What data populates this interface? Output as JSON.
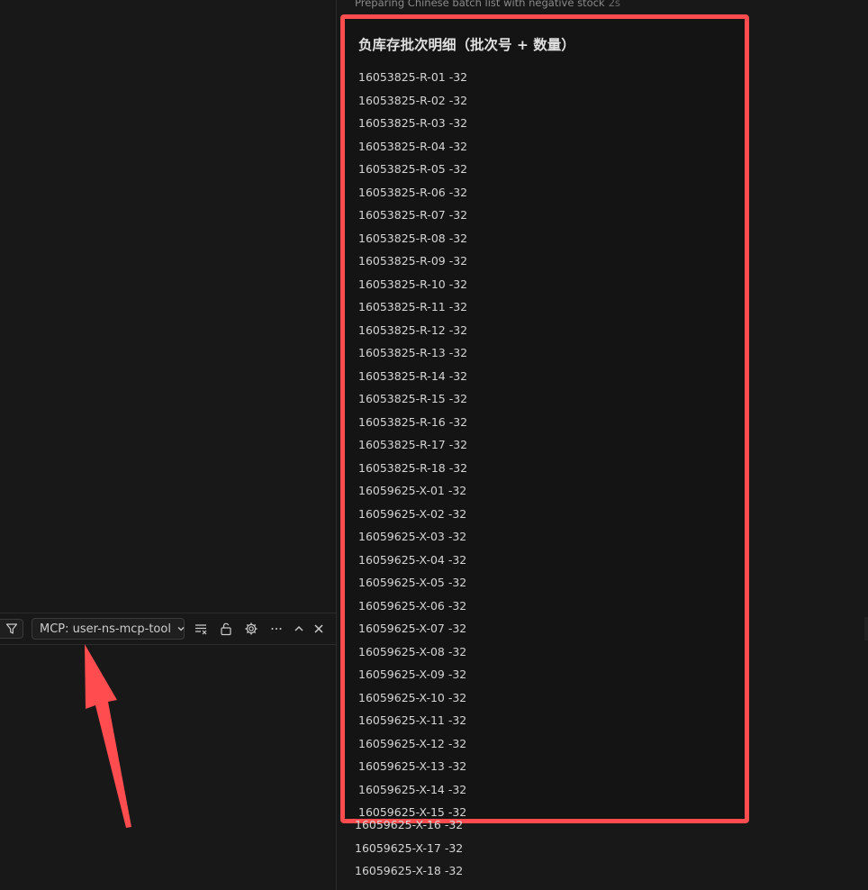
{
  "toolbar": {
    "mcp_select_label": "MCP: user-ns-mcp-tool",
    "icons": [
      "filter-icon",
      "chevron-down-icon",
      "clear-output-icon",
      "unlock-icon",
      "gear-icon",
      "more-icon",
      "chevron-up-icon",
      "close-icon"
    ]
  },
  "status": {
    "text": "Preparing Chinese batch list with negative stock",
    "duration": "2s"
  },
  "panel": {
    "title": "负库存批次明细（批次号 + 数量）",
    "items": [
      "16053825-R-01 -32",
      "16053825-R-02 -32",
      "16053825-R-03 -32",
      "16053825-R-04 -32",
      "16053825-R-05 -32",
      "16053825-R-06 -32",
      "16053825-R-07 -32",
      "16053825-R-08 -32",
      "16053825-R-09 -32",
      "16053825-R-10 -32",
      "16053825-R-11 -32",
      "16053825-R-12 -32",
      "16053825-R-13 -32",
      "16053825-R-14 -32",
      "16053825-R-15 -32",
      "16053825-R-16 -32",
      "16053825-R-17 -32",
      "16053825-R-18 -32",
      "16059625-X-01 -32",
      "16059625-X-02 -32",
      "16059625-X-03 -32",
      "16059625-X-04 -32",
      "16059625-X-05 -32",
      "16059625-X-06 -32",
      "16059625-X-07 -32",
      "16059625-X-08 -32",
      "16059625-X-09 -32",
      "16059625-X-10 -32",
      "16059625-X-11 -32",
      "16059625-X-12 -32",
      "16059625-X-13 -32",
      "16059625-X-14 -32",
      "16059625-X-15 -32"
    ],
    "items_below": [
      "16059625-X-16 -32",
      "16059625-X-17 -32",
      "16059625-X-18 -32"
    ]
  },
  "colors": {
    "highlight_border": "#ff4d4f",
    "arrow": "#ff4d4f",
    "background": "#181818"
  }
}
